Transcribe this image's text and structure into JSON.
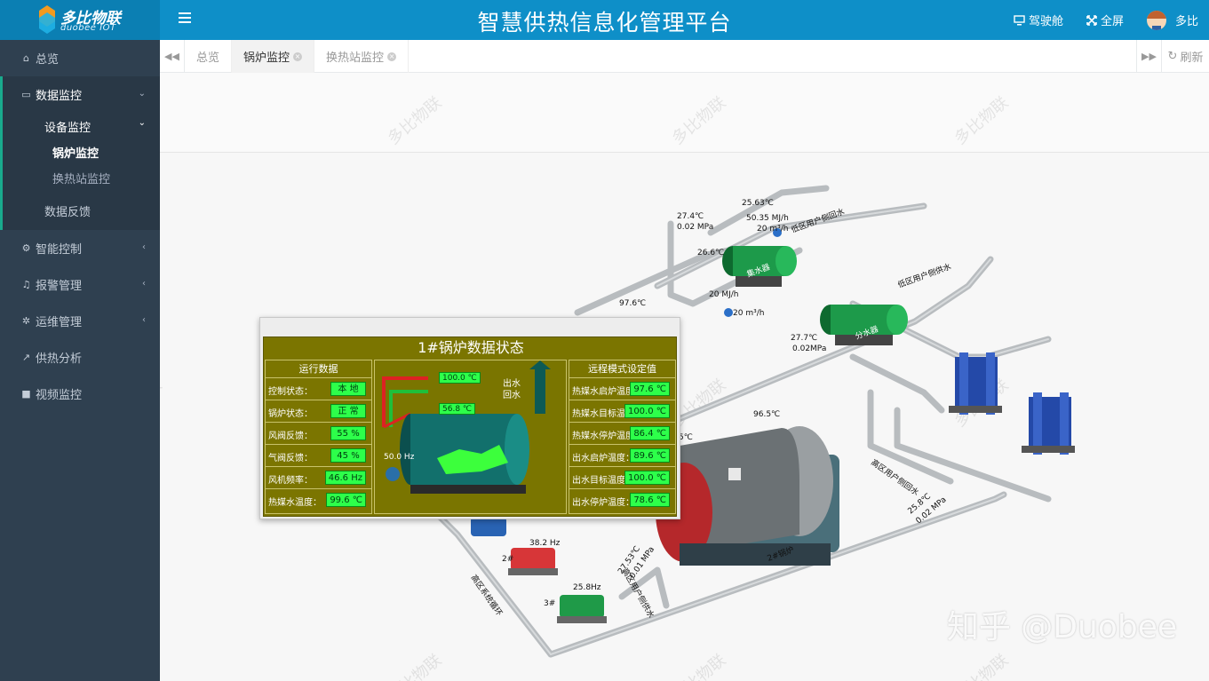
{
  "app": {
    "logo_text": "多比物联",
    "logo_sub": "duobee IOT",
    "title": "智慧供热信息化管理平台"
  },
  "top_actions": {
    "cockpit": "驾驶舱",
    "fullscreen": "全屏",
    "user": "多比"
  },
  "sidebar": {
    "overview": "总览",
    "data_monitor": "数据监控",
    "device_monitor": "设备监控",
    "boiler_monitor": "锅炉监控",
    "exchange_monitor": "换热站监控",
    "data_feedback": "数据反馈",
    "smart_control": "智能控制",
    "alarm_mgmt": "报警管理",
    "ops_mgmt": "运维管理",
    "heat_analysis": "供热分析",
    "video_monitor": "视频监控"
  },
  "tabs": {
    "items": [
      "总览",
      "锅炉监控",
      "换热站监控"
    ],
    "refresh": "刷新"
  },
  "watermark": "多比物联",
  "zhihu": "知乎 @Duobee",
  "scene_labels": {
    "t1": "27.4℃",
    "p1": "0.02 MPa",
    "t2": "25.63℃",
    "e1": "50.35 MJ/h",
    "f1": "20  m³/h",
    "low_return": "低区用户侧回水",
    "t3": "26.6℃",
    "collector": "集水器",
    "low_supply": "低区用户侧供水",
    "e2": "20  MJ/h",
    "f2": "20  m³/h",
    "t4": "97.6℃",
    "t5": "27.7℃",
    "p2": "0.02MPa",
    "distributor": "分水器",
    "t6": "96.5℃",
    "t7": "5℃",
    "high_return": "高区用户侧回水",
    "t8": "25.8℃",
    "p3": "0.02 MPa",
    "boiler2": "2#锅炉",
    "hz1": "38.2 Hz",
    "pump2": "2#",
    "t9": "27.53℃",
    "p4": "0.01 MPa",
    "high_supply": "高区用户侧供水",
    "hz2": "25.8Hz",
    "pump3": "3#",
    "high_loop": "高区系统循环"
  },
  "boiler_panel": {
    "title": "1#锅炉数据状态",
    "left_header": "运行数据",
    "right_header": "远程模式设定值",
    "left_rows": [
      {
        "label": "控制状态：",
        "value": "本  地"
      },
      {
        "label": "锅炉状态：",
        "value": "正  常"
      },
      {
        "label": "风阀反馈：",
        "value": "55  %"
      },
      {
        "label": "气阀反馈：",
        "value": "45  %"
      },
      {
        "label": "风机频率：",
        "value": "46.6 Hz"
      },
      {
        "label": "热媒水温度：",
        "value": "99.6 ℃"
      }
    ],
    "right_rows": [
      {
        "label": "热媒水启炉温度：",
        "value": "97.6 ℃"
      },
      {
        "label": "热媒水目标温度：",
        "value": "100.0 ℃"
      },
      {
        "label": "热媒水停炉温度：",
        "value": "86.4 ℃"
      },
      {
        "label": "出水启炉温度：",
        "value": "89.6 ℃"
      },
      {
        "label": "出水目标温度：",
        "value": "100.0 ℃"
      },
      {
        "label": "出水停炉温度：",
        "value": "78.6 ℃"
      }
    ],
    "supply_temp": "100.0 ℃",
    "return_temp": "56.8 ℃",
    "supply_label": "出水",
    "return_label": "回水",
    "fan_hz": "50.0 Hz"
  },
  "colors": {
    "header": "#0e8fc8",
    "sidebar": "#2f4050",
    "panel_bg": "#7b7500",
    "readout": "#2dff4a"
  }
}
